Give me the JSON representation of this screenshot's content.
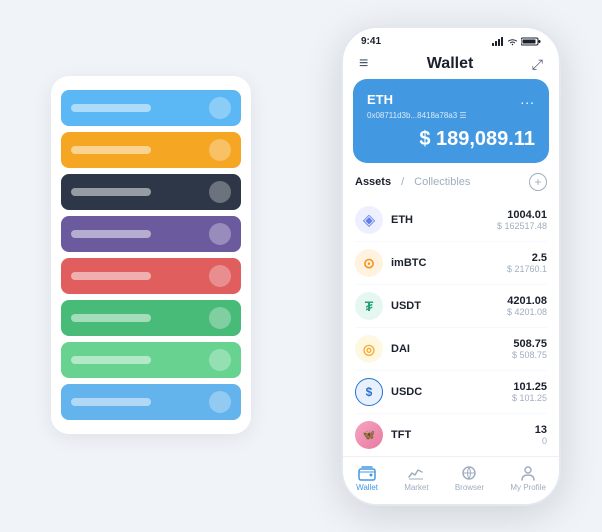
{
  "background_cards": [
    {
      "color": "card-blue",
      "id": "blue-card"
    },
    {
      "color": "card-orange",
      "id": "orange-card"
    },
    {
      "color": "card-dark",
      "id": "dark-card"
    },
    {
      "color": "card-purple",
      "id": "purple-card"
    },
    {
      "color": "card-red",
      "id": "red-card"
    },
    {
      "color": "card-green",
      "id": "green-card"
    },
    {
      "color": "card-lightgreen",
      "id": "lightgreen-card"
    },
    {
      "color": "card-lightblue",
      "id": "lightblue-card"
    }
  ],
  "status_bar": {
    "time": "9:41",
    "wifi": "wifi",
    "battery": "battery"
  },
  "header": {
    "menu_icon": "≡",
    "title": "Wallet",
    "expand_icon": "⤢"
  },
  "eth_card": {
    "title": "ETH",
    "dots": "...",
    "address": "0x08711d3b...8418a78a3 ☰",
    "balance": "$ 189,089.11"
  },
  "assets_section": {
    "tab_active": "Assets",
    "divider": "/",
    "tab_inactive": "Collectibles",
    "add_icon": "+"
  },
  "assets": [
    {
      "name": "ETH",
      "icon": "◈",
      "icon_color": "#627EEA",
      "amount": "1004.01",
      "usd": "$ 162517.48"
    },
    {
      "name": "imBTC",
      "icon": "⊙",
      "icon_color": "#F7931A",
      "amount": "2.5",
      "usd": "$ 21760.1"
    },
    {
      "name": "USDT",
      "icon": "₮",
      "icon_color": "#26A17B",
      "amount": "4201.08",
      "usd": "$ 4201.08"
    },
    {
      "name": "DAI",
      "icon": "◎",
      "icon_color": "#F5AC37",
      "amount": "508.75",
      "usd": "$ 508.75"
    },
    {
      "name": "USDC",
      "icon": "$",
      "icon_color": "#2775CA",
      "amount": "101.25",
      "usd": "$ 101.25"
    },
    {
      "name": "TFT",
      "icon": "🦋",
      "icon_color": "#E879A0",
      "amount": "13",
      "usd": "0"
    }
  ],
  "bottom_nav": [
    {
      "label": "Wallet",
      "icon": "◎",
      "active": true
    },
    {
      "label": "Market",
      "icon": "📊",
      "active": false
    },
    {
      "label": "Browser",
      "icon": "👤",
      "active": false
    },
    {
      "label": "My Profile",
      "icon": "👤",
      "active": false
    }
  ]
}
